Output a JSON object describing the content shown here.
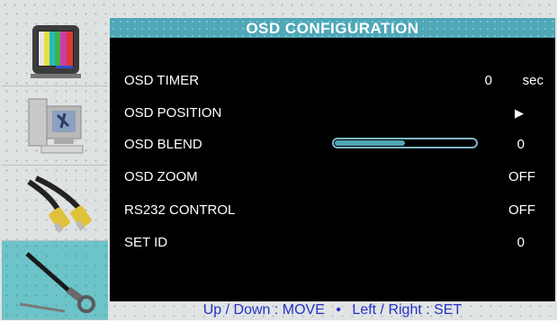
{
  "title": "OSD CONFIGURATION",
  "sidebar": {
    "items": [
      {
        "icon": "tv-color-bars-icon",
        "active": false
      },
      {
        "icon": "computer-icon",
        "active": false
      },
      {
        "icon": "av-cables-icon",
        "active": false
      },
      {
        "icon": "wrench-icon",
        "active": true
      }
    ]
  },
  "menu": [
    {
      "label": "OSD TIMER",
      "value": "0",
      "unit": "sec"
    },
    {
      "label": "OSD POSITION",
      "value": "▶"
    },
    {
      "label": "OSD BLEND",
      "value": "0",
      "level": 0.5
    },
    {
      "label": "OSD ZOOM",
      "value": "OFF"
    },
    {
      "label": "RS232 CONTROL",
      "value": "OFF"
    },
    {
      "label": "SET ID",
      "value": "0"
    }
  ],
  "footer": {
    "move": "Up / Down : MOVE",
    "bullet": "•",
    "set": "Left / Right : SET"
  },
  "colors": {
    "accent": "#4fa7b7",
    "footer_text": "#2432c8",
    "active_tile": "#6cc4c9"
  }
}
